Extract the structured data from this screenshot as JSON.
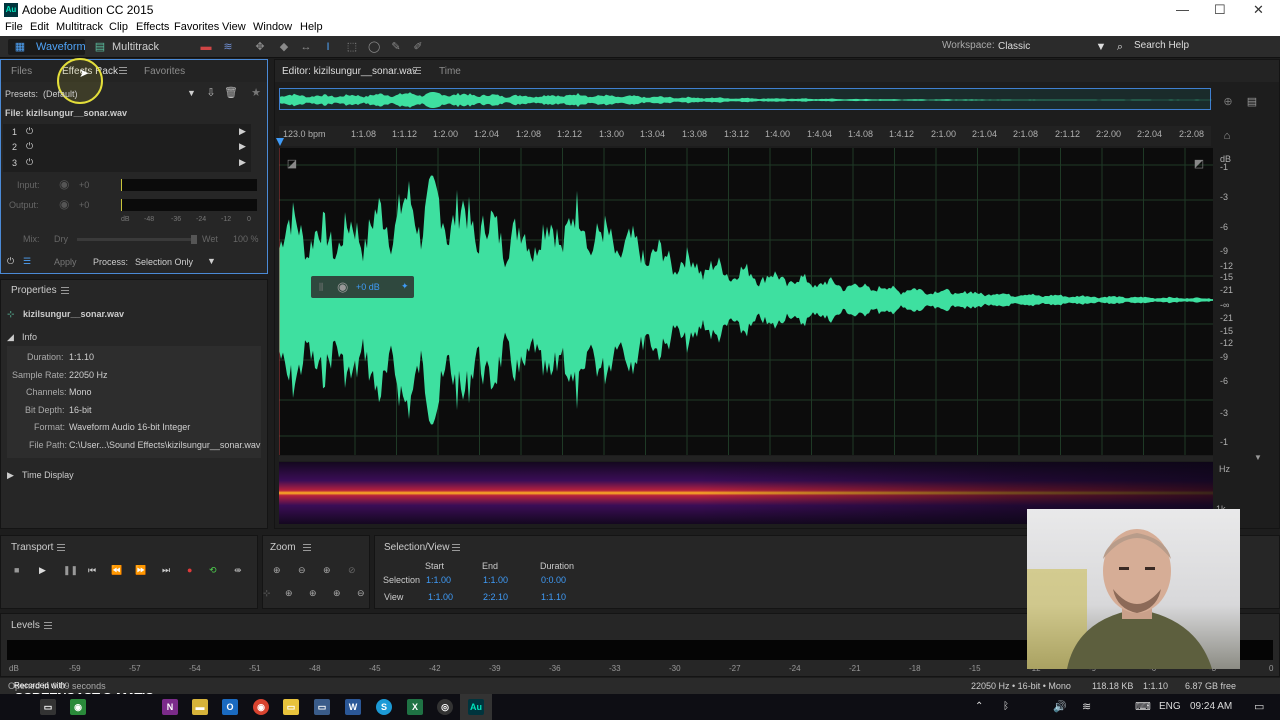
{
  "window": {
    "title": "Adobe Audition CC 2015",
    "app_icon": "Au"
  },
  "menu": [
    "File",
    "Edit",
    "Multitrack",
    "Clip",
    "Effects",
    "Favorites",
    "View",
    "Window",
    "Help"
  ],
  "toolbar": {
    "waveform": "Waveform",
    "multitrack": "Multitrack",
    "workspace_label": "Workspace:",
    "workspace_value": "Classic",
    "search_label": "Search Help"
  },
  "left_tabs": [
    "Files",
    "Effects Rack",
    "Favorites"
  ],
  "effects_rack": {
    "presets_label": "Presets:",
    "presets_value": "(Default)",
    "file_label": "File: kizilsungur__sonar.wav",
    "slots": [
      "1",
      "2",
      "3"
    ],
    "input_label": "Input:",
    "input_value": "+0",
    "output_label": "Output:",
    "output_value": "+0",
    "meter_scale": [
      "dB",
      "-48",
      "-36",
      "-24",
      "-12",
      "0"
    ],
    "mix_label": "Mix:",
    "dry": "Dry",
    "wet": "Wet",
    "wet_pct": "100 %",
    "apply": "Apply",
    "process_label": "Process:",
    "process_value": "Selection Only"
  },
  "properties": {
    "title": "Properties",
    "filename": "kizilsungur__sonar.wav",
    "info": "Info",
    "rows": [
      {
        "label": "Duration:",
        "value": "1:1.10"
      },
      {
        "label": "Sample Rate:",
        "value": "22050 Hz"
      },
      {
        "label": "Channels:",
        "value": "Mono"
      },
      {
        "label": "Bit Depth:",
        "value": "16-bit"
      },
      {
        "label": "Format:",
        "value": "Waveform Audio 16-bit Integer"
      },
      {
        "label": "File Path:",
        "value": "C:\\User...\\Sound Effects\\kizilsungur__sonar.wav"
      }
    ],
    "time_display": "Time Display"
  },
  "editor": {
    "tab": "Editor: kizilsungur__sonar.wav",
    "time_tab": "Time",
    "ruler": [
      "123.0 bpm",
      "1:1.08",
      "1:1.12",
      "1:2.00",
      "1:2.04",
      "1:2.08",
      "1:2.12",
      "1:3.00",
      "1:3.04",
      "1:3.08",
      "1:3.12",
      "1:4.00",
      "1:4.04",
      "1:4.08",
      "1:4.12",
      "2:1.00",
      "2:1.04",
      "2:1.08",
      "2:1.12",
      "2:2.00",
      "2:2.04",
      "2:2.08"
    ],
    "db_scale": [
      "dB",
      "-1",
      "-3",
      "-6",
      "-9",
      "-12",
      "-15",
      "-21",
      "-∞",
      "-21",
      "-15",
      "-12",
      "-9",
      "-6",
      "-3",
      "-1"
    ],
    "hud_gain": "+0 dB",
    "spectral_scale": [
      "Hz",
      "1k"
    ],
    "waveform_color": "#3ee0a0"
  },
  "transport": {
    "title": "Transport"
  },
  "zoom": {
    "title": "Zoom"
  },
  "selection_view": {
    "title": "Selection/View",
    "headers": [
      "Start",
      "End",
      "Duration"
    ],
    "rows": [
      {
        "label": "Selection",
        "start": "1:1.00",
        "end": "1:1.00",
        "duration": "0:0.00"
      },
      {
        "label": "View",
        "start": "1:1.00",
        "end": "2:2.10",
        "duration": "1:1.10"
      }
    ]
  },
  "levels": {
    "title": "Levels",
    "scale": [
      "dB",
      "-59",
      "-57",
      "-54",
      "-51",
      "-48",
      "-45",
      "-42",
      "-39",
      "-36",
      "-33",
      "-30",
      "-27",
      "-24",
      "-21",
      "-18",
      "-15",
      "-12",
      "-9",
      "-6",
      "-3",
      "0"
    ]
  },
  "status": {
    "left": "Opened in 0.09 seconds",
    "format": "22050 Hz • 16-bit • Mono",
    "size": "118.18 KB",
    "duration": "1:1.10",
    "free": "6.87 GB free"
  },
  "watermark": "SCREENCAST-O-MATIC",
  "watermark_small": "Recorded with",
  "taskbar": {
    "lang": "ENG",
    "time": "09:24 AM"
  }
}
